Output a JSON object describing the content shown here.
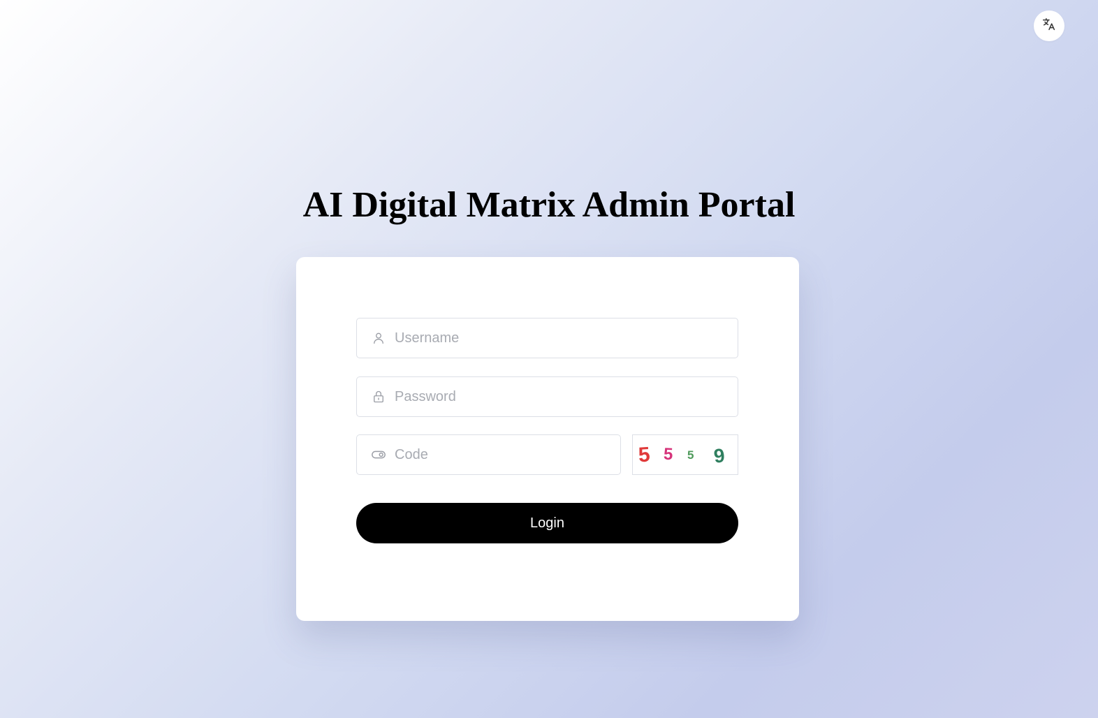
{
  "header": {
    "language_icon": "translate-icon"
  },
  "page": {
    "title": "AI Digital Matrix Admin Portal"
  },
  "form": {
    "username": {
      "placeholder": "Username",
      "value": "",
      "icon": "user-icon"
    },
    "password": {
      "placeholder": "Password",
      "value": "",
      "icon": "lock-icon"
    },
    "code": {
      "placeholder": "Code",
      "value": "",
      "icon": "toggle-icon"
    },
    "captcha": {
      "chars": [
        {
          "char": "5",
          "color": "#e03a3a"
        },
        {
          "char": "5",
          "color": "#d6337a"
        },
        {
          "char": "5",
          "color": "#4e9a5a"
        },
        {
          "char": "9",
          "color": "#2f7f5f"
        }
      ]
    },
    "login_label": "Login"
  },
  "colors": {
    "primary_button": "#000000",
    "card_background": "#ffffff",
    "input_border": "#dcdfe6",
    "placeholder": "#a8abb2"
  }
}
